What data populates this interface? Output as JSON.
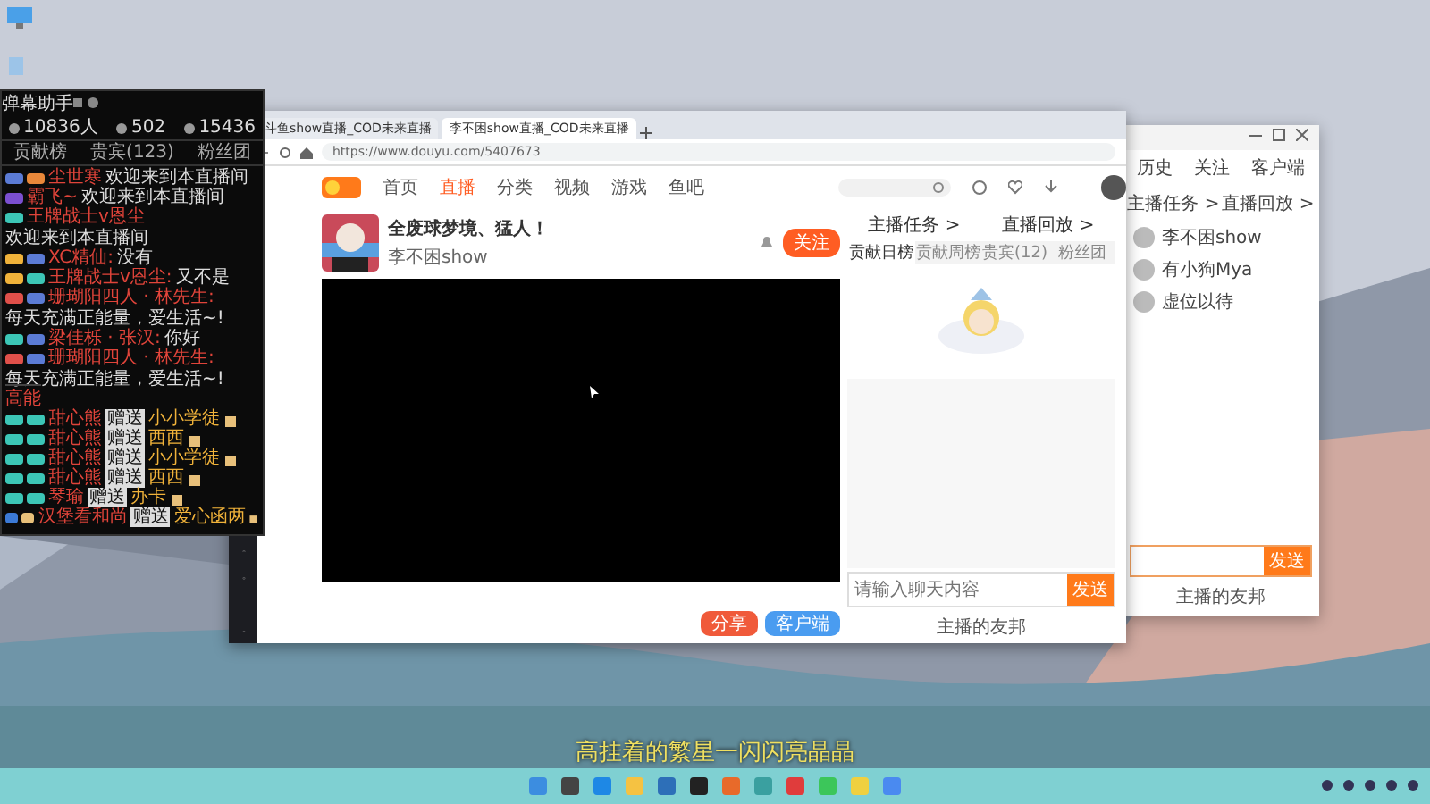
{
  "chat_panel": {
    "title": "弹幕助手",
    "stats": [
      "10836人",
      "502",
      "15436"
    ],
    "tabs": [
      {
        "label": "贡献榜",
        "selected": false
      },
      {
        "label": "贵宾(123)",
        "selected": false
      },
      {
        "label": "粉丝团",
        "selected": false
      }
    ],
    "messages": [
      {
        "kind": "chat",
        "badges": [
          {
            "color": "#5b7bd5"
          },
          {
            "color": "#e8883a"
          }
        ],
        "user": "尘世寒",
        "text": "欢迎来到本直播间"
      },
      {
        "kind": "chat",
        "badges": [
          {
            "color": "#7b4fd0"
          }
        ],
        "user": "霸飞~",
        "text": "欢迎来到本直播间"
      },
      {
        "kind": "chat",
        "badges": [
          {
            "color": "#3cc6b6"
          }
        ],
        "user": "王牌战士v恩尘",
        "text": "欢迎来到本直播间"
      },
      {
        "kind": "chat",
        "badges": [
          {
            "color": "#f0b23a"
          },
          {
            "color": "#5b7bd5"
          }
        ],
        "user": "XC精仙:",
        "text": "没有"
      },
      {
        "kind": "chat",
        "badges": [
          {
            "color": "#f0b23a"
          },
          {
            "color": "#3cc6b6"
          }
        ],
        "user": "王牌战士v恩尘:",
        "text": "又不是"
      },
      {
        "kind": "chat",
        "badges": [
          {
            "color": "#e0504a"
          },
          {
            "color": "#5b7bd5"
          }
        ],
        "user": "珊瑚阳四人 · 林先生:",
        "text": "每天充满正能量，爱生活~!"
      },
      {
        "kind": "chat",
        "badges": [
          {
            "color": "#3cc6b6"
          },
          {
            "color": "#5b7bd5"
          }
        ],
        "user": "梁佳栎 · 张汉:",
        "text": "你好"
      },
      {
        "kind": "chat",
        "badges": [
          {
            "color": "#e0504a"
          },
          {
            "color": "#5b7bd5"
          }
        ],
        "user": "珊瑚阳四人 · 林先生:",
        "text": "每天充满正能量，爱生活~!"
      },
      {
        "kind": "section",
        "text": "高能"
      },
      {
        "kind": "gift",
        "badges": [
          {
            "color": "#3cc6b6"
          },
          {
            "color": "#3cc6b6"
          }
        ],
        "user": "甜心熊",
        "action": "赠送",
        "text": "小小学徒"
      },
      {
        "kind": "gift",
        "badges": [
          {
            "color": "#3cc6b6"
          },
          {
            "color": "#3cc6b6"
          }
        ],
        "user": "甜心熊",
        "action": "赠送",
        "text": "西西"
      },
      {
        "kind": "gift",
        "badges": [
          {
            "color": "#3cc6b6"
          },
          {
            "color": "#3cc6b6"
          }
        ],
        "user": "甜心熊",
        "action": "赠送",
        "text": "小小学徒"
      },
      {
        "kind": "gift",
        "badges": [
          {
            "color": "#3cc6b6"
          },
          {
            "color": "#3cc6b6"
          }
        ],
        "user": "甜心熊",
        "action": "赠送",
        "text": "西西"
      },
      {
        "kind": "gift",
        "badges": [
          {
            "color": "#3cc6b6"
          },
          {
            "color": "#3cc6b6"
          }
        ],
        "user": "琴瑜",
        "action": "赠送",
        "text": "办卡"
      },
      {
        "kind": "gift",
        "badges": [
          {
            "color": "#3c7ad6"
          },
          {
            "color": "#e8c07a"
          }
        ],
        "user": "汉堡看和尚",
        "action": "赠送",
        "text": "爱心函两"
      }
    ]
  },
  "browser": {
    "tabs": [
      {
        "title": "斗鱼show直播_COD未来直播",
        "selected": false
      },
      {
        "title": "李不困show直播_COD未来直播",
        "selected": true
      }
    ],
    "url": "https://www.douyu.com/5407673",
    "site_nav": [
      {
        "label": "首页",
        "selected": false
      },
      {
        "label": "直播",
        "selected": true
      },
      {
        "label": "分类",
        "selected": false
      },
      {
        "label": "视频",
        "selected": false
      },
      {
        "label": "游戏",
        "selected": false
      },
      {
        "label": "鱼吧",
        "selected": false
      }
    ],
    "room": {
      "title": "全废球梦境、猛人！",
      "streamer": "李不困show",
      "follow_button": "关注"
    },
    "side_links": [
      "主播任务 >",
      "直播回放 >"
    ],
    "side_tabs": [
      {
        "label": "贡献日榜",
        "selected": true
      },
      {
        "label": "贡献周榜",
        "selected": false
      },
      {
        "label": "贵宾(12)",
        "selected": false
      },
      {
        "label": "粉丝团",
        "selected": false
      }
    ],
    "chat_input": {
      "placeholder": "请输入聊天内容"
    },
    "send_button": "发送",
    "share_buttons": [
      "分享",
      "客户端"
    ],
    "bottom_label": "主播的友邦"
  },
  "second_window": {
    "nav": [
      "历史",
      "关注",
      "客户端"
    ],
    "links": [
      "主播任务 >",
      "直播回放 >"
    ],
    "users": [
      "李不困show",
      "有小狗Mya",
      "虚位以待"
    ],
    "send_button": "发送",
    "bottom_label": "主播的友邦"
  },
  "subtitle": "高挂着的繁星一闪闪亮晶晶"
}
